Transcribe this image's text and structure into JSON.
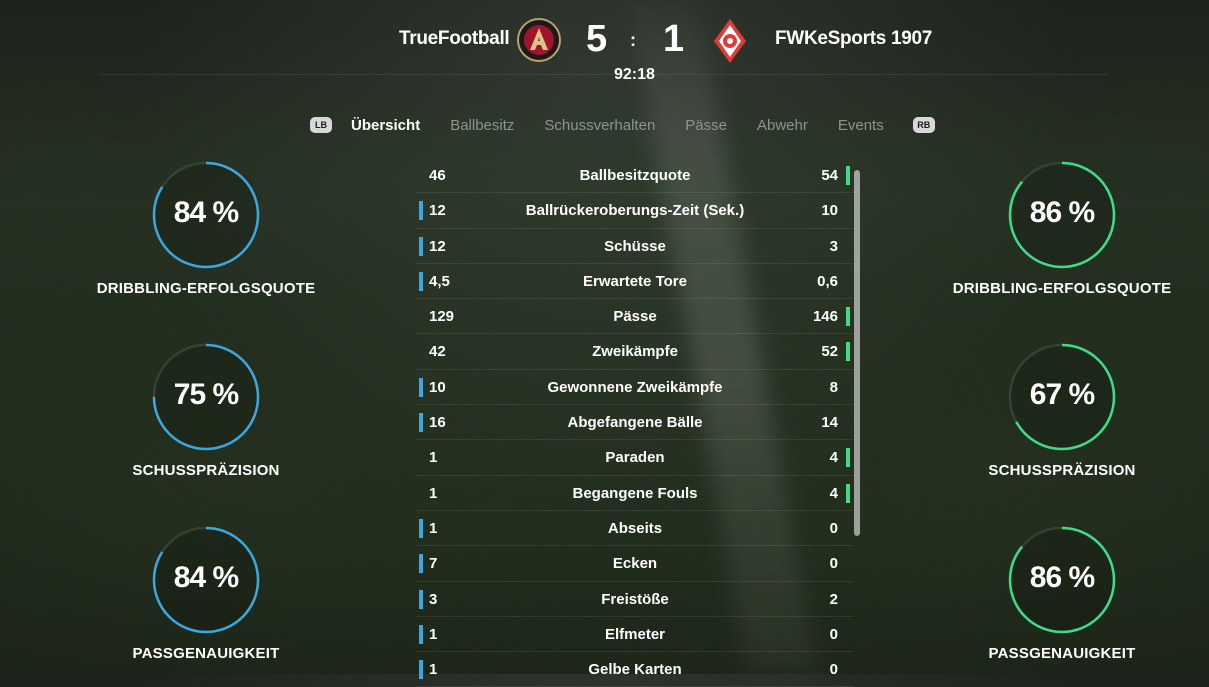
{
  "header": {
    "home_team": "TrueFootball",
    "away_team": "FWKeSports 1907",
    "home_score": "5",
    "away_score": "1",
    "separator": ":",
    "clock": "92:18"
  },
  "tabs": {
    "left_hint": "LB",
    "right_hint": "RB",
    "items": [
      "Übersicht",
      "Ballbesitz",
      "Schussverhalten",
      "Pässe",
      "Abwehr",
      "Events"
    ],
    "active_index": 0
  },
  "rings": {
    "home": [
      {
        "value": "84 %",
        "label": "DRIBBLING-ERFOLGSQUOTE",
        "percent": 84
      },
      {
        "value": "75 %",
        "label": "SCHUSSPRÄZISION",
        "percent": 75
      },
      {
        "value": "84 %",
        "label": "PASSGENAUIGKEIT",
        "percent": 84
      }
    ],
    "away": [
      {
        "value": "86 %",
        "label": "DRIBBLING-ERFOLGSQUOTE",
        "percent": 86
      },
      {
        "value": "67 %",
        "label": "SCHUSSPRÄZISION",
        "percent": 67
      },
      {
        "value": "86 %",
        "label": "PASSGENAUIGKEIT",
        "percent": 86
      }
    ]
  },
  "colors": {
    "home_accent": "#3aa7e0",
    "away_accent": "#3fdc86"
  },
  "stats": [
    {
      "home": "46",
      "label": "Ballbesitzquote",
      "away": "54",
      "leader": "away"
    },
    {
      "home": "12",
      "label": "Ballrückeroberungs-Zeit (Sek.)",
      "away": "10",
      "leader": "home"
    },
    {
      "home": "12",
      "label": "Schüsse",
      "away": "3",
      "leader": "home"
    },
    {
      "home": "4,5",
      "label": "Erwartete Tore",
      "away": "0,6",
      "leader": "home"
    },
    {
      "home": "129",
      "label": "Pässe",
      "away": "146",
      "leader": "away"
    },
    {
      "home": "42",
      "label": "Zweikämpfe",
      "away": "52",
      "leader": "away"
    },
    {
      "home": "10",
      "label": "Gewonnene Zweikämpfe",
      "away": "8",
      "leader": "home"
    },
    {
      "home": "16",
      "label": "Abgefangene Bälle",
      "away": "14",
      "leader": "home"
    },
    {
      "home": "1",
      "label": "Paraden",
      "away": "4",
      "leader": "away"
    },
    {
      "home": "1",
      "label": "Begangene Fouls",
      "away": "4",
      "leader": "away"
    },
    {
      "home": "1",
      "label": "Abseits",
      "away": "0",
      "leader": "home"
    },
    {
      "home": "7",
      "label": "Ecken",
      "away": "0",
      "leader": "home"
    },
    {
      "home": "3",
      "label": "Freistöße",
      "away": "2",
      "leader": "home"
    },
    {
      "home": "1",
      "label": "Elfmeter",
      "away": "0",
      "leader": "home"
    },
    {
      "home": "1",
      "label": "Gelbe Karten",
      "away": "0",
      "leader": "home"
    }
  ]
}
